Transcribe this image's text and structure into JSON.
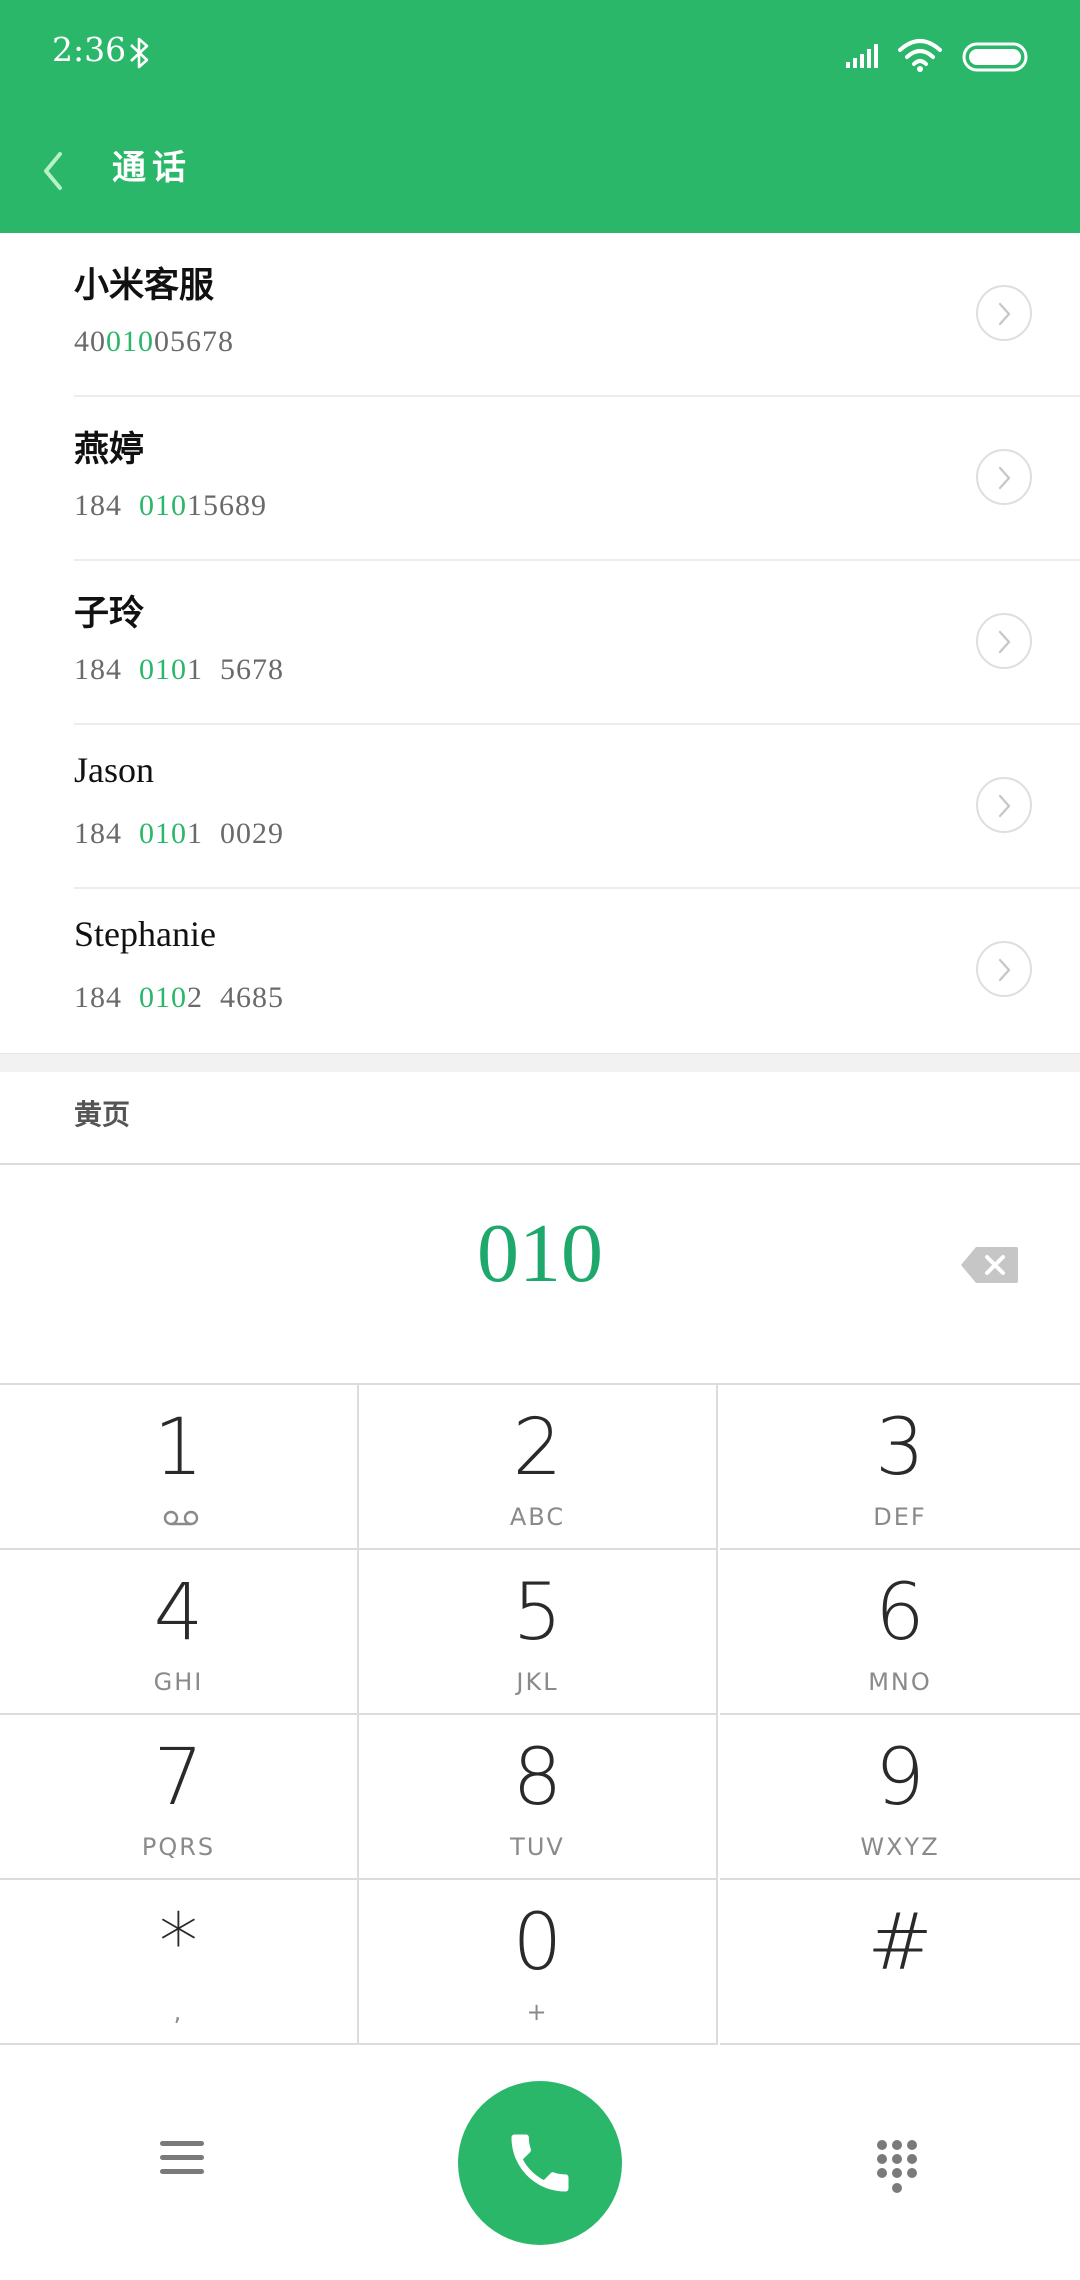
{
  "status_bar": {
    "time": "2:36",
    "icons": [
      "bluetooth-icon",
      "signal-icon",
      "wifi-icon",
      "battery-icon"
    ]
  },
  "header": {
    "title": "通话",
    "back_icon": "chevron-left-icon",
    "background_color": "#2ab769"
  },
  "contacts": [
    {
      "name": "小米客服",
      "number_parts": [
        "40",
        "010",
        "05678"
      ]
    },
    {
      "name": "燕婷",
      "number_parts": [
        "184  ",
        "010",
        "15689"
      ]
    },
    {
      "name": "子玲",
      "number_parts": [
        "184  ",
        "010",
        "1  5678"
      ]
    },
    {
      "name": "Jason",
      "number_parts": [
        "184  ",
        "010",
        "1  0029"
      ]
    },
    {
      "name": "Stephanie",
      "number_parts": [
        "184  ",
        "010",
        "2  4685"
      ]
    }
  ],
  "yellow_pages": {
    "label": "黄页"
  },
  "dialer": {
    "dialed_number": "010",
    "accent_color": "#1fa86c"
  },
  "keypad": {
    "keys": [
      {
        "digit": "1",
        "letters": ""
      },
      {
        "digit": "2",
        "letters": "ABC"
      },
      {
        "digit": "3",
        "letters": "DEF"
      },
      {
        "digit": "4",
        "letters": "GHI"
      },
      {
        "digit": "5",
        "letters": "JKL"
      },
      {
        "digit": "6",
        "letters": "MNO"
      },
      {
        "digit": "7",
        "letters": "PQRS"
      },
      {
        "digit": "8",
        "letters": "TUV"
      },
      {
        "digit": "9",
        "letters": "WXYZ"
      },
      {
        "digit": "*",
        "letters": ","
      },
      {
        "digit": "0",
        "letters": "+"
      },
      {
        "digit": "#",
        "letters": ""
      }
    ]
  },
  "bottom_bar": {
    "icons": [
      "menu-icon",
      "phone-icon",
      "dialpad-icon"
    ]
  }
}
